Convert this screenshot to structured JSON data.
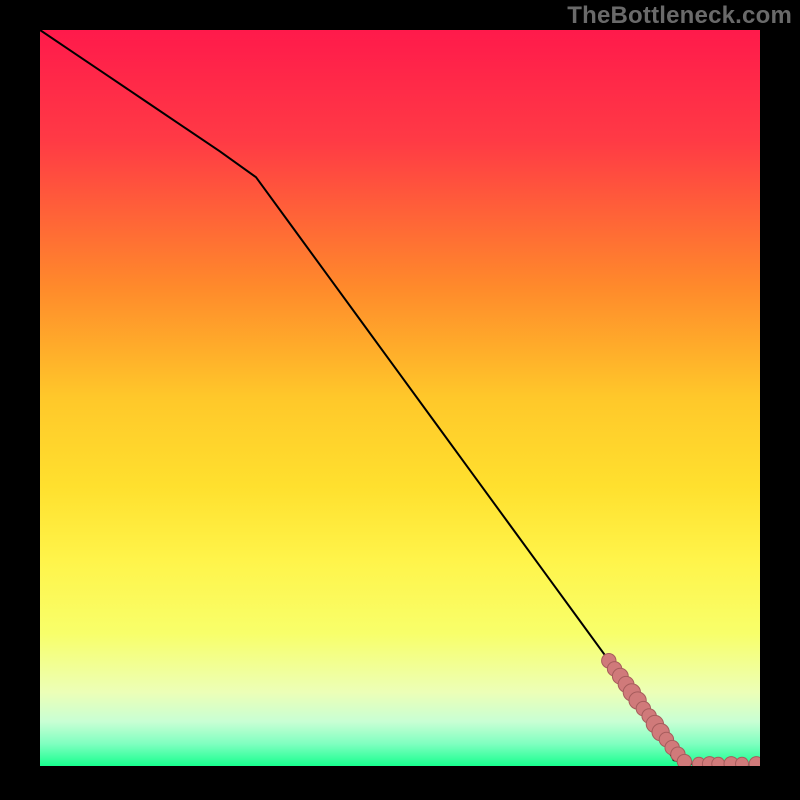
{
  "watermark": "TheBottleneck.com",
  "colors": {
    "background": "#000000",
    "gradient_stops": [
      {
        "offset": 0.0,
        "color": "#ff1a4b"
      },
      {
        "offset": 0.15,
        "color": "#ff3a45"
      },
      {
        "offset": 0.35,
        "color": "#ff8a2b"
      },
      {
        "offset": 0.5,
        "color": "#ffc82a"
      },
      {
        "offset": 0.62,
        "color": "#ffe02e"
      },
      {
        "offset": 0.72,
        "color": "#fff44a"
      },
      {
        "offset": 0.82,
        "color": "#f8ff6a"
      },
      {
        "offset": 0.9,
        "color": "#ecffb7"
      },
      {
        "offset": 0.94,
        "color": "#c8ffd4"
      },
      {
        "offset": 0.97,
        "color": "#7fffc0"
      },
      {
        "offset": 1.0,
        "color": "#18ff8e"
      }
    ],
    "line": "#000000",
    "marker_fill": "#d07a7a",
    "marker_stroke": "#a65c5c"
  },
  "chart_data": {
    "type": "line",
    "title": "",
    "xlabel": "",
    "ylabel": "",
    "xlim": [
      0,
      100
    ],
    "ylim": [
      0,
      100
    ],
    "line_points": [
      {
        "x": 0,
        "y": 100
      },
      {
        "x": 5,
        "y": 96.7
      },
      {
        "x": 10,
        "y": 93.4
      },
      {
        "x": 15,
        "y": 90.1
      },
      {
        "x": 20,
        "y": 86.8
      },
      {
        "x": 25,
        "y": 83.5
      },
      {
        "x": 30,
        "y": 80.0
      },
      {
        "x": 35,
        "y": 73.3
      },
      {
        "x": 40,
        "y": 66.6
      },
      {
        "x": 45,
        "y": 59.9
      },
      {
        "x": 50,
        "y": 53.2
      },
      {
        "x": 55,
        "y": 46.5
      },
      {
        "x": 60,
        "y": 39.8
      },
      {
        "x": 65,
        "y": 33.1
      },
      {
        "x": 70,
        "y": 26.4
      },
      {
        "x": 75,
        "y": 19.7
      },
      {
        "x": 80,
        "y": 13.0
      },
      {
        "x": 85,
        "y": 6.3
      },
      {
        "x": 88,
        "y": 0.8
      },
      {
        "x": 90,
        "y": 0.3
      },
      {
        "x": 95,
        "y": 0.2
      },
      {
        "x": 100,
        "y": 0.2
      }
    ],
    "markers": [
      {
        "x": 79.0,
        "y": 14.3,
        "r": 1.0
      },
      {
        "x": 79.8,
        "y": 13.2,
        "r": 1.0
      },
      {
        "x": 80.6,
        "y": 12.2,
        "r": 1.1
      },
      {
        "x": 81.4,
        "y": 11.1,
        "r": 1.1
      },
      {
        "x": 82.2,
        "y": 10.0,
        "r": 1.2
      },
      {
        "x": 83.0,
        "y": 8.9,
        "r": 1.2
      },
      {
        "x": 83.8,
        "y": 7.8,
        "r": 1.0
      },
      {
        "x": 84.6,
        "y": 6.8,
        "r": 1.0
      },
      {
        "x": 85.4,
        "y": 5.7,
        "r": 1.2
      },
      {
        "x": 86.2,
        "y": 4.6,
        "r": 1.2
      },
      {
        "x": 87.0,
        "y": 3.6,
        "r": 1.0
      },
      {
        "x": 87.8,
        "y": 2.5,
        "r": 1.0
      },
      {
        "x": 88.6,
        "y": 1.6,
        "r": 1.0
      },
      {
        "x": 89.5,
        "y": 0.6,
        "r": 1.0
      },
      {
        "x": 91.5,
        "y": 0.3,
        "r": 0.9
      },
      {
        "x": 93.0,
        "y": 0.3,
        "r": 1.0
      },
      {
        "x": 94.2,
        "y": 0.3,
        "r": 0.9
      },
      {
        "x": 96.0,
        "y": 0.3,
        "r": 1.0
      },
      {
        "x": 97.5,
        "y": 0.3,
        "r": 0.9
      },
      {
        "x": 99.5,
        "y": 0.3,
        "r": 1.0
      }
    ]
  }
}
